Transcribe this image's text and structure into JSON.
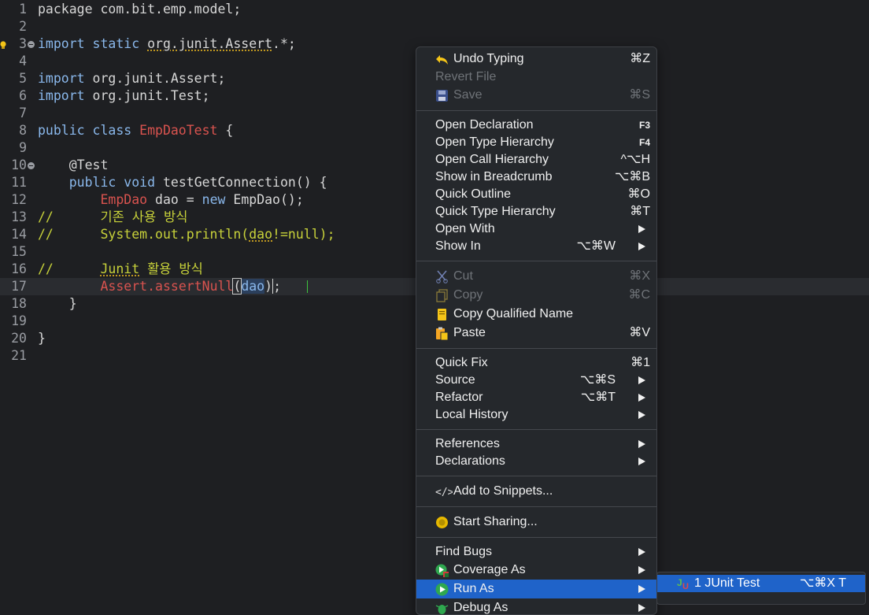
{
  "editor": {
    "lines": [
      {
        "num": "1",
        "parts": [
          {
            "t": "package com.bit.emp.model;",
            "c": "txt"
          }
        ]
      },
      {
        "num": "2",
        "parts": []
      },
      {
        "num": "3",
        "parts": [
          {
            "t": "import static ",
            "c": "kw"
          },
          {
            "t": "org.junit.Assert",
            "c": "txt warn"
          },
          {
            "t": ".*;",
            "c": "txt"
          }
        ]
      },
      {
        "num": "4",
        "parts": []
      },
      {
        "num": "5",
        "parts": [
          {
            "t": "import ",
            "c": "kw"
          },
          {
            "t": "org.junit.Assert;",
            "c": "txt"
          }
        ]
      },
      {
        "num": "6",
        "parts": [
          {
            "t": "import ",
            "c": "kw"
          },
          {
            "t": "org.junit.Test;",
            "c": "txt"
          }
        ]
      },
      {
        "num": "7",
        "parts": []
      },
      {
        "num": "8",
        "parts": [
          {
            "t": "public class ",
            "c": "kw"
          },
          {
            "t": "EmpDaoTest",
            "c": "cls"
          },
          {
            "t": " {",
            "c": "txt"
          }
        ]
      },
      {
        "num": "9",
        "parts": []
      },
      {
        "num": "10",
        "parts": [
          {
            "t": "    @Test",
            "c": "ann"
          }
        ]
      },
      {
        "num": "11",
        "parts": [
          {
            "t": "    public void ",
            "c": "kw"
          },
          {
            "t": "testGetConnection() {",
            "c": "txt"
          }
        ]
      },
      {
        "num": "12",
        "parts": [
          {
            "t": "        ",
            "c": "txt"
          },
          {
            "t": "EmpDao",
            "c": "cls"
          },
          {
            "t": " dao = ",
            "c": "txt"
          },
          {
            "t": "new ",
            "c": "kw"
          },
          {
            "t": "EmpDao();",
            "c": "txt"
          }
        ]
      },
      {
        "num": "13",
        "parts": [
          {
            "t": "//      기존 사용 방식",
            "c": "cmt"
          }
        ]
      },
      {
        "num": "14",
        "parts": [
          {
            "t": "//      System.out.println(",
            "c": "cmt"
          },
          {
            "t": "dao",
            "c": "cmt warn"
          },
          {
            "t": "!=null);",
            "c": "cmt"
          }
        ]
      },
      {
        "num": "15",
        "parts": []
      },
      {
        "num": "16",
        "parts": [
          {
            "t": "//      ",
            "c": "cmt"
          },
          {
            "t": "Junit",
            "c": "cmt warn"
          },
          {
            "t": " 활용 방식",
            "c": "cmt"
          }
        ]
      },
      {
        "num": "17",
        "parts": [
          {
            "t": "        ",
            "c": "txt"
          },
          {
            "t": "Assert",
            "c": "cls"
          },
          {
            "t": ".assertNull",
            "c": "cls"
          },
          {
            "t": "(",
            "c": "txt sel-box"
          },
          {
            "t": "dao",
            "c": "hl"
          },
          {
            "t": ")",
            "c": "txt"
          },
          {
            "t": ";",
            "c": "txt caret"
          }
        ]
      },
      {
        "num": "18",
        "parts": [
          {
            "t": "    }",
            "c": "txt"
          }
        ]
      },
      {
        "num": "19",
        "parts": []
      },
      {
        "num": "20",
        "parts": [
          {
            "t": "}",
            "c": "txt"
          }
        ]
      },
      {
        "num": "21",
        "parts": []
      }
    ]
  },
  "menu": {
    "groups": [
      [
        {
          "label": "Undo Typing",
          "shortcut": "⌘Z",
          "icon": "undo-icon"
        },
        {
          "label": "Revert File",
          "shortcut": "",
          "disabled": true
        },
        {
          "label": "Save",
          "shortcut": "⌘S",
          "disabled": true,
          "icon": "save-icon"
        }
      ],
      [
        {
          "label": "Open Declaration",
          "shortcut": "F3",
          "small": true
        },
        {
          "label": "Open Type Hierarchy",
          "shortcut": "F4",
          "small": true
        },
        {
          "label": "Open Call Hierarchy",
          "shortcut": "^⌥H"
        },
        {
          "label": "Show in Breadcrumb",
          "shortcut": "⌥⌘B"
        },
        {
          "label": "Quick Outline",
          "shortcut": "⌘O"
        },
        {
          "label": "Quick Type Hierarchy",
          "shortcut": "⌘T"
        },
        {
          "label": "Open With",
          "submenu": true
        },
        {
          "label": "Show In",
          "shortcut": "⌥⌘W",
          "submenu": true
        }
      ],
      [
        {
          "label": "Cut",
          "shortcut": "⌘X",
          "disabled": true,
          "icon": "cut-icon"
        },
        {
          "label": "Copy",
          "shortcut": "⌘C",
          "disabled": true,
          "icon": "copy-icon"
        },
        {
          "label": "Copy Qualified Name",
          "icon": "copy-qualified-icon"
        },
        {
          "label": "Paste",
          "shortcut": "⌘V",
          "icon": "paste-icon"
        }
      ],
      [
        {
          "label": "Quick Fix",
          "shortcut": "⌘1"
        },
        {
          "label": "Source",
          "shortcut": "⌥⌘S",
          "submenu": true
        },
        {
          "label": "Refactor",
          "shortcut": "⌥⌘T",
          "submenu": true
        },
        {
          "label": "Local History",
          "submenu": true
        }
      ],
      [
        {
          "label": "References",
          "submenu": true
        },
        {
          "label": "Declarations",
          "submenu": true
        }
      ],
      [
        {
          "label": "Add to Snippets...",
          "icon": "snippet-icon"
        }
      ],
      [
        {
          "label": "Start Sharing...",
          "icon": "sharing-icon"
        }
      ],
      [
        {
          "label": "Find Bugs",
          "submenu": true
        },
        {
          "label": "Coverage As",
          "submenu": true,
          "icon": "coverage-icon"
        },
        {
          "label": "Run As",
          "submenu": true,
          "icon": "run-icon",
          "active": true
        },
        {
          "label": "Debug As",
          "submenu": true,
          "icon": "debug-icon"
        }
      ]
    ]
  },
  "submenu": {
    "item": {
      "label": "1 JUnit Test",
      "shortcut": "⌥⌘X T",
      "icon": "junit-icon"
    }
  },
  "colors": {
    "accent": "#1f63c9",
    "comment": "#c8d23a",
    "keyword": "#8ab8ec",
    "type": "#d9534f"
  }
}
